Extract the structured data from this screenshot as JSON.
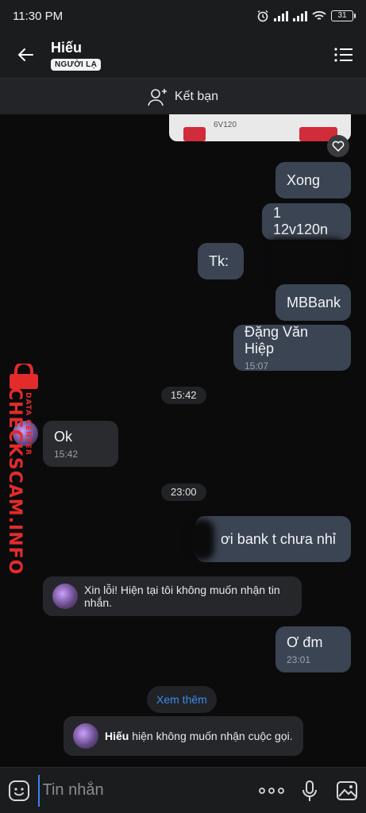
{
  "status_bar": {
    "time": "11:30 PM",
    "battery": "31"
  },
  "header": {
    "title": "Hiếu",
    "badge": "NGƯỜI LẠ"
  },
  "friend_bar": {
    "label": "Kết bạn"
  },
  "image_card": {
    "caption": "6V120"
  },
  "messages": [
    {
      "text": "Xong",
      "dir": "out"
    },
    {
      "text": "1 12v120n",
      "dir": "out"
    },
    {
      "text": "Tk:",
      "dir": "out"
    },
    {
      "text": "MBBank",
      "dir": "out"
    },
    {
      "text": "Đặng Văn Hiệp",
      "time": "15:07",
      "dir": "out"
    },
    {
      "text": "Ok",
      "time": "15:42",
      "dir": "in"
    },
    {
      "text": "ơi bank t chưa  nhỉ",
      "dir": "out"
    },
    {
      "text": "Ơ đm",
      "time": "23:01",
      "dir": "out"
    }
  ],
  "separators": {
    "first": "15:42",
    "second": "23:00"
  },
  "system": {
    "blocked_msg": "Xin lỗi! Hiện tại tôi không muốn nhận tin nhắn.",
    "see_more": "Xem thêm",
    "call_name": "Hiếu",
    "call_text": " hiện không muốn nhận cuộc gọi."
  },
  "watermark": {
    "main": "CHECKSCAM.INFO",
    "side": "DATA CENTER"
  },
  "input": {
    "placeholder": "Tin nhắn"
  }
}
